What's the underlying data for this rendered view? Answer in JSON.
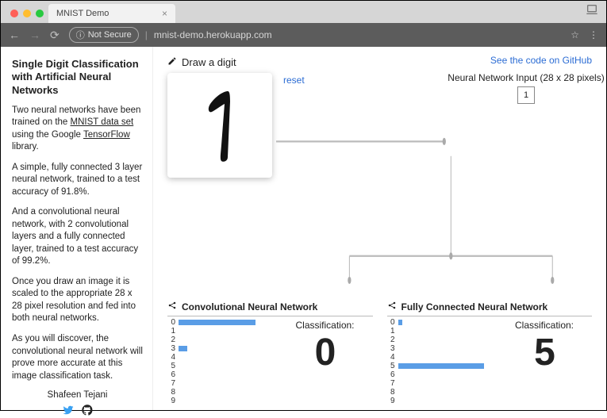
{
  "browser": {
    "tab_title": "MNIST Demo",
    "not_secure": "Not Secure",
    "url": "mnist-demo.herokuapp.com"
  },
  "sidebar": {
    "title": "Single Digit Classification with Artificial Neural Networks",
    "p1a": "Two neural networks have been trained on the ",
    "p1_link": "MNIST data set",
    "p1b": " using the Google ",
    "p1_link2": "TensorFlow",
    "p1c": " library.",
    "p2": "A simple, fully connected 3 layer neural network, trained to a test accuracy of 91.8%.",
    "p3": "And a convolutional neural network, with 2 convolutional layers and a fully connected layer, trained to a test accuracy of 99.2%.",
    "p4": "Once you draw an image it is scaled to the appropriate 28 x 28 pixel resolution and fed into both neural networks.",
    "p5": "As you will discover, the convolutional neural network will prove more accurate at this image classification task.",
    "author": "Shafeen Tejani"
  },
  "main": {
    "github_link": "See the code on GitHub",
    "draw_label": "Draw a digit",
    "reset": "reset",
    "nn_input_label": "Neural Network Input (28 x 28 pixels)",
    "nn_input_value": "1"
  },
  "results": {
    "cnn": {
      "title": "Convolutional Neural Network",
      "class_label": "Classification:",
      "class_value": "0",
      "bars": [
        {
          "label": "0",
          "pct": 70
        },
        {
          "label": "1",
          "pct": 0
        },
        {
          "label": "2",
          "pct": 0
        },
        {
          "label": "3",
          "pct": 8
        },
        {
          "label": "4",
          "pct": 0
        },
        {
          "label": "5",
          "pct": 0
        },
        {
          "label": "6",
          "pct": 0
        },
        {
          "label": "7",
          "pct": 0
        },
        {
          "label": "8",
          "pct": 0
        },
        {
          "label": "9",
          "pct": 0
        }
      ]
    },
    "fcn": {
      "title": "Fully Connected Neural Network",
      "class_label": "Classification:",
      "class_value": "5",
      "bars": [
        {
          "label": "0",
          "pct": 4
        },
        {
          "label": "1",
          "pct": 0
        },
        {
          "label": "2",
          "pct": 0
        },
        {
          "label": "3",
          "pct": 0
        },
        {
          "label": "4",
          "pct": 0
        },
        {
          "label": "5",
          "pct": 78
        },
        {
          "label": "6",
          "pct": 0
        },
        {
          "label": "7",
          "pct": 0
        },
        {
          "label": "8",
          "pct": 0
        },
        {
          "label": "9",
          "pct": 0
        }
      ]
    }
  }
}
